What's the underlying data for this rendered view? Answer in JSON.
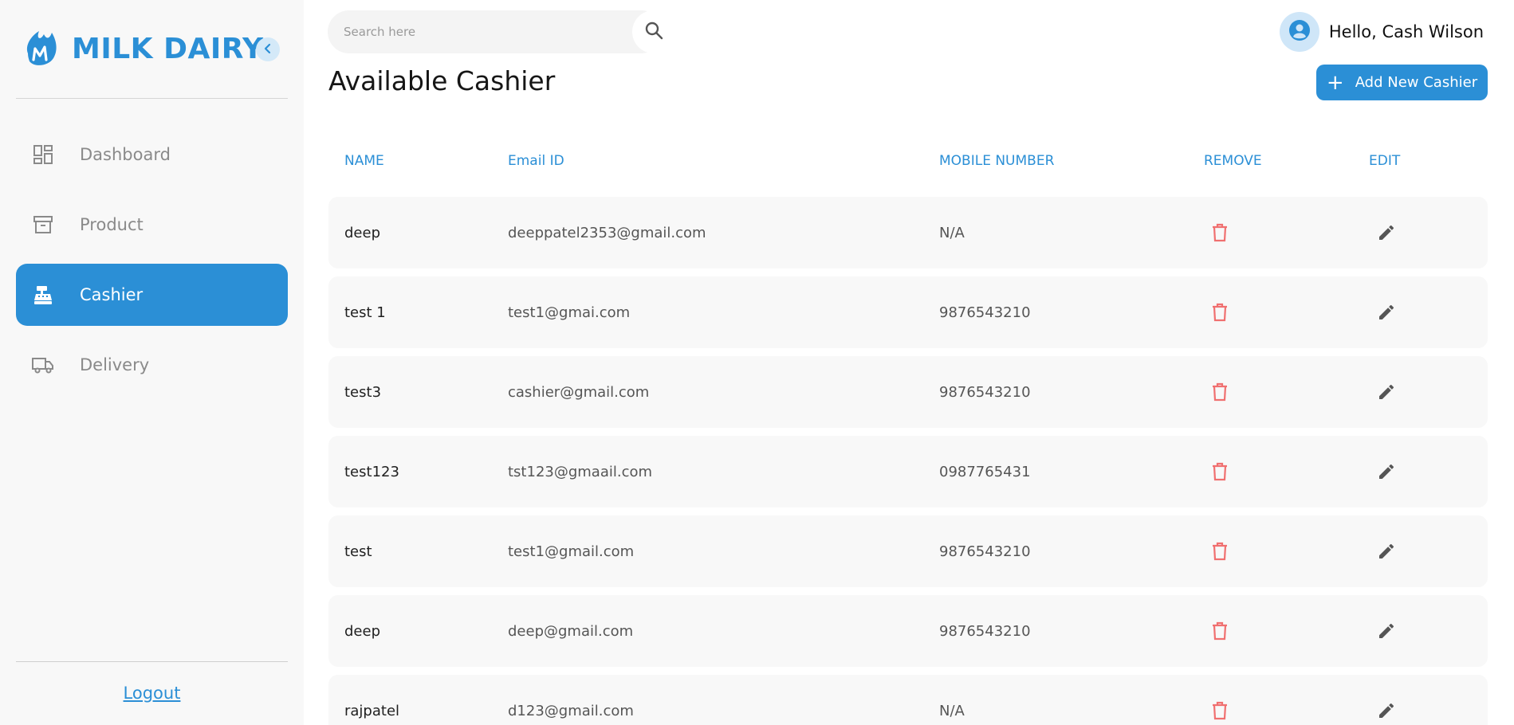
{
  "brand": {
    "name": "MILK DAIRY"
  },
  "sidebar": {
    "items": [
      {
        "label": "Dashboard",
        "icon": "dashboard-icon"
      },
      {
        "label": "Product",
        "icon": "archive-box-icon"
      },
      {
        "label": "Cashier",
        "icon": "cash-register-icon",
        "active": true
      },
      {
        "label": "Delivery",
        "icon": "truck-icon"
      }
    ],
    "logout": "Logout"
  },
  "header": {
    "search_placeholder": "Search here",
    "greeting": "Hello, Cash Wilson"
  },
  "main": {
    "title": "Available Cashier",
    "add_button": "Add New Cashier",
    "columns": [
      "NAME",
      "Email ID",
      "MOBILE NUMBER",
      "REMOVE",
      "EDIT"
    ],
    "rows": [
      {
        "name": "deep",
        "email": "deeppatel2353@gmail.com",
        "mobile": "N/A"
      },
      {
        "name": "test 1",
        "email": "test1@gmai.com",
        "mobile": "9876543210"
      },
      {
        "name": "test3",
        "email": "cashier@gmail.com",
        "mobile": "9876543210"
      },
      {
        "name": "test123",
        "email": "tst123@gmaail.com",
        "mobile": "0987765431"
      },
      {
        "name": "test",
        "email": "test1@gmail.com",
        "mobile": "9876543210"
      },
      {
        "name": "deep",
        "email": "deep@gmail.com",
        "mobile": "9876543210"
      },
      {
        "name": "rajpatel",
        "email": "d123@gmail.com",
        "mobile": "N/A"
      }
    ]
  },
  "colors": {
    "accent": "#2b8fd6",
    "remove": "#f07070",
    "edit": "#555555",
    "sidebar_bg": "#f8f8f8"
  }
}
